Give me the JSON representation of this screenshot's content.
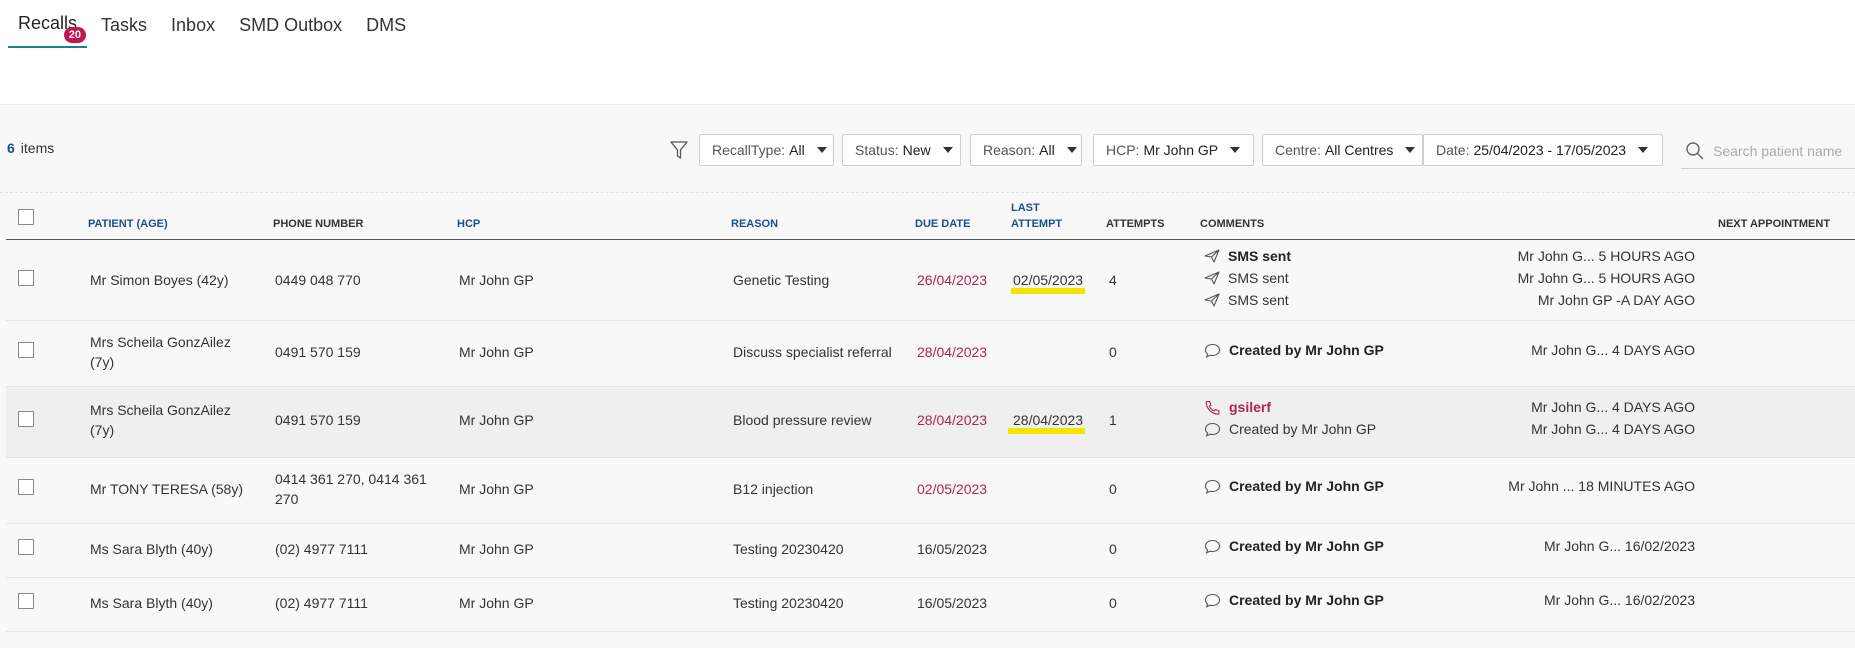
{
  "tabs": [
    {
      "label": "Recalls",
      "badge": "20",
      "active": true
    },
    {
      "label": "Tasks"
    },
    {
      "label": "Inbox"
    },
    {
      "label": "SMD Outbox"
    },
    {
      "label": "DMS"
    }
  ],
  "toolbar": {
    "items_count": "6",
    "items_label": "items",
    "filters": [
      {
        "label": "RecallType:",
        "value": "All"
      },
      {
        "label": "Status:",
        "value": "New"
      },
      {
        "label": "Reason:",
        "value": "All"
      },
      {
        "label": "HCP:",
        "value": "Mr John GP"
      },
      {
        "label": "Centre:",
        "value": "All Centres"
      },
      {
        "label": "Date:",
        "value": "25/04/2023 - 17/05/2023"
      }
    ],
    "search_placeholder": "Search patient name"
  },
  "table": {
    "headers": {
      "patient": "PATIENT (AGE)",
      "phone": "PHONE NUMBER",
      "hcp": "HCP",
      "reason": "REASON",
      "due": "DUE DATE",
      "last_attempt_1": "LAST",
      "last_attempt_2": "ATTEMPT",
      "attempts": "ATTEMPTS",
      "comments": "COMMENTS",
      "next": "NEXT APPOINTMENT"
    },
    "rows": [
      {
        "patient": "Mr Simon Boyes (42y)",
        "phone": "0449 048 770",
        "hcp": "Mr John GP",
        "reason": "Genetic Testing",
        "due": "26/04/2023",
        "last_attempt": "02/05/2023",
        "attempts": "4",
        "comments": [
          {
            "icon": "send-icon",
            "text": "SMS sent",
            "meta": "Mr John G... 5 HOURS AGO"
          },
          {
            "icon": "send-icon",
            "text": "SMS sent",
            "meta": "Mr John G... 5 HOURS AGO"
          },
          {
            "icon": "send-icon",
            "text": "SMS sent",
            "meta": "Mr John GP -A DAY AGO"
          }
        ]
      },
      {
        "patient": "Mrs Scheila GonzAilez",
        "patient_line2": "(7y)",
        "phone": "0491 570 159",
        "hcp": "Mr John GP",
        "reason": "Discuss specialist referral",
        "due": "28/04/2023",
        "last_attempt": "",
        "attempts": "0",
        "comments": [
          {
            "icon": "chat-bubble-icon",
            "text": "Created by Mr John GP",
            "meta": "Mr John G... 4 DAYS AGO"
          }
        ]
      },
      {
        "patient": "Mrs Scheila GonzAilez",
        "patient_line2": "(7y)",
        "phone": "0491 570 159",
        "hcp": "Mr John GP",
        "reason": "Blood pressure review",
        "due": "28/04/2023",
        "last_attempt": "28/04/2023",
        "attempts": "1",
        "comments": [
          {
            "icon": "phone-icon",
            "text": "gsilerf",
            "meta": "Mr John G... 4 DAYS AGO"
          },
          {
            "icon": "chat-bubble-icon",
            "text": "Created by Mr John GP",
            "meta": "Mr John G... 4 DAYS AGO"
          }
        ]
      },
      {
        "patient": "Mr TONY TERESA (58y)",
        "phone": "0414 361 270, 0414 361",
        "phone_line2": "270",
        "hcp": "Mr John GP",
        "reason": "B12 injection",
        "due": "02/05/2023",
        "last_attempt": "",
        "attempts": "0",
        "comments": [
          {
            "icon": "chat-bubble-icon",
            "text": "Created by Mr John GP",
            "meta": "Mr John ... 18 MINUTES AGO"
          }
        ]
      },
      {
        "patient": "Ms Sara Blyth (40y)",
        "phone": "(02) 4977 7111",
        "hcp": "Mr John GP",
        "reason": "Testing 20230420",
        "due": "16/05/2023",
        "last_attempt": "",
        "attempts": "0",
        "comments": [
          {
            "icon": "chat-bubble-icon",
            "text": "Created by Mr John GP",
            "meta": "Mr John G... 16/02/2023"
          }
        ]
      },
      {
        "patient": "Ms Sara Blyth (40y)",
        "phone": "(02) 4977 7111",
        "hcp": "Mr John GP",
        "reason": "Testing 20230420",
        "due": "16/05/2023",
        "last_attempt": "",
        "attempts": "0",
        "comments": [
          {
            "icon": "chat-bubble-icon",
            "text": "Created by Mr John GP",
            "meta": "Mr John G... 16/02/2023"
          }
        ]
      }
    ]
  },
  "colors": {
    "accent": "#1a7f8e",
    "badge": "#c0184e",
    "due_red": "#b0254f",
    "highlight": "#f5e400",
    "header_blue": "#1b4f8a"
  }
}
